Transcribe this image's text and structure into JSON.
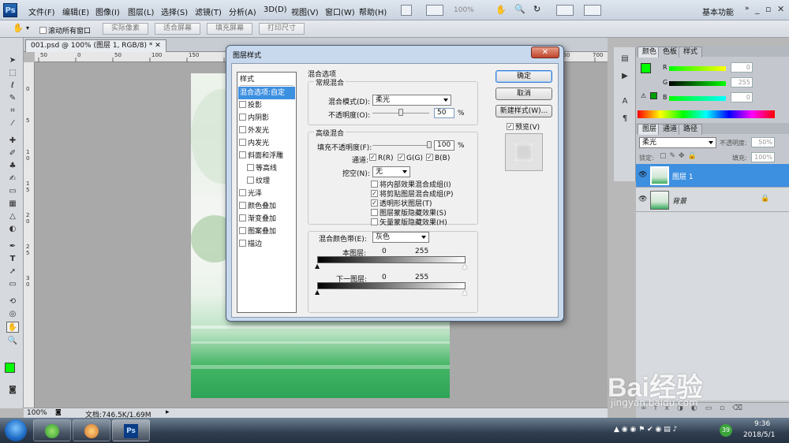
{
  "menubar": {
    "logo": "Ps",
    "items": [
      "文件(F)",
      "编辑(E)",
      "图像(I)",
      "图层(L)",
      "选择(S)",
      "滤镜(T)",
      "分析(A)",
      "3D(D)",
      "视图(V)",
      "窗口(W)",
      "帮助(H)"
    ],
    "zoom": "100%",
    "workspace": "基本功能",
    "window_controls": [
      "_",
      "▫",
      "✕"
    ]
  },
  "optionsbar": {
    "scroll_all_label": "滚动所有窗口",
    "buttons": [
      "实际像素",
      "适合屏幕",
      "填充屏幕",
      "打印尺寸"
    ]
  },
  "document": {
    "tab_label": "001.psd @ 100% (图层 1, RGB/8) *",
    "ruler_top": [
      "50",
      "0",
      "50",
      "100",
      "150",
      "200",
      "250",
      "300",
      "350",
      "400",
      "450",
      "500",
      "550",
      "600",
      "650",
      "700"
    ],
    "ruler_left": [
      "0",
      "5",
      "1",
      "0",
      "1",
      "5",
      "2",
      "0",
      "2",
      "5",
      "3",
      "0"
    ]
  },
  "statusbar": {
    "zoom": "100%",
    "doc_info": "文档:746.5K/1.69M"
  },
  "color_panel": {
    "tabs": [
      "颜色",
      "色板",
      "样式"
    ],
    "values": [
      "0",
      "255",
      "0"
    ],
    "channel_labels": [
      "R",
      "G",
      "B"
    ],
    "fg_color": "#00ff00",
    "bg_color": "#000080"
  },
  "layers_panel": {
    "tabs": [
      "图层",
      "通道",
      "路径"
    ],
    "blend_mode": "柔光",
    "opacity_label": "不透明度:",
    "opacity_value": "50%",
    "lock_label": "锁定:",
    "fill_label": "填充:",
    "fill_value": "100%",
    "layers": [
      {
        "name": "图层 1",
        "selected": true
      },
      {
        "name": "背景",
        "selected": false
      }
    ]
  },
  "dialog": {
    "title": "图层样式",
    "close": "✕",
    "style_list": [
      {
        "label": "样式",
        "checkbox": false,
        "selected": false
      },
      {
        "label": "混合选项:自定",
        "checkbox": false,
        "selected": true
      },
      {
        "label": "投影",
        "checkbox": true
      },
      {
        "label": "内阴影",
        "checkbox": true
      },
      {
        "label": "外发光",
        "checkbox": true
      },
      {
        "label": "内发光",
        "checkbox": true
      },
      {
        "label": "斜面和浮雕",
        "checkbox": true
      },
      {
        "label": "等高线",
        "checkbox": true,
        "indent": true
      },
      {
        "label": "纹理",
        "checkbox": true,
        "indent": true
      },
      {
        "label": "光泽",
        "checkbox": true
      },
      {
        "label": "颜色叠加",
        "checkbox": true
      },
      {
        "label": "渐变叠加",
        "checkbox": true
      },
      {
        "label": "图案叠加",
        "checkbox": true
      },
      {
        "label": "描边",
        "checkbox": true
      }
    ],
    "section_title": "混合选项",
    "general": {
      "title": "常规混合",
      "mode_label": "混合模式(D):",
      "mode_value": "柔光",
      "opacity_label": "不透明度(O):",
      "opacity_value": "50",
      "opacity_fraction": 0.5,
      "percent": "%"
    },
    "advanced": {
      "title": "高级混合",
      "fill_label": "填充不透明度(F):",
      "fill_value": "100",
      "fill_fraction": 1.0,
      "percent": "%",
      "channels_label": "通道:",
      "channels": [
        "R(R)",
        "G(G)",
        "B(B)"
      ],
      "knockout_label": "挖空(N):",
      "knockout_value": "无",
      "options": [
        {
          "label": "将内部效果混合成组(I)",
          "checked": false
        },
        {
          "label": "将剪贴图层混合成组(P)",
          "checked": true
        },
        {
          "label": "透明形状图层(T)",
          "checked": true
        },
        {
          "label": "图层蒙版隐藏效果(S)",
          "checked": false
        },
        {
          "label": "矢量蒙版隐藏效果(H)",
          "checked": false
        }
      ]
    },
    "blend_if": {
      "label": "混合颜色带(E):",
      "value": "灰色",
      "this_layer_label": "本图层:",
      "this_layer_low": "0",
      "this_layer_high": "255",
      "under_layer_label": "下一图层:",
      "under_layer_low": "0",
      "under_layer_high": "255"
    },
    "buttons": {
      "ok": "确定",
      "cancel": "取消",
      "new_style": "新建样式(W)...",
      "preview_label": "预览(V)"
    }
  },
  "taskbar": {
    "time": "9:36",
    "date": "2018/5/1",
    "badge": "39"
  },
  "watermark": {
    "text": "Bai经验",
    "url": "jingyan.baidu.com"
  }
}
